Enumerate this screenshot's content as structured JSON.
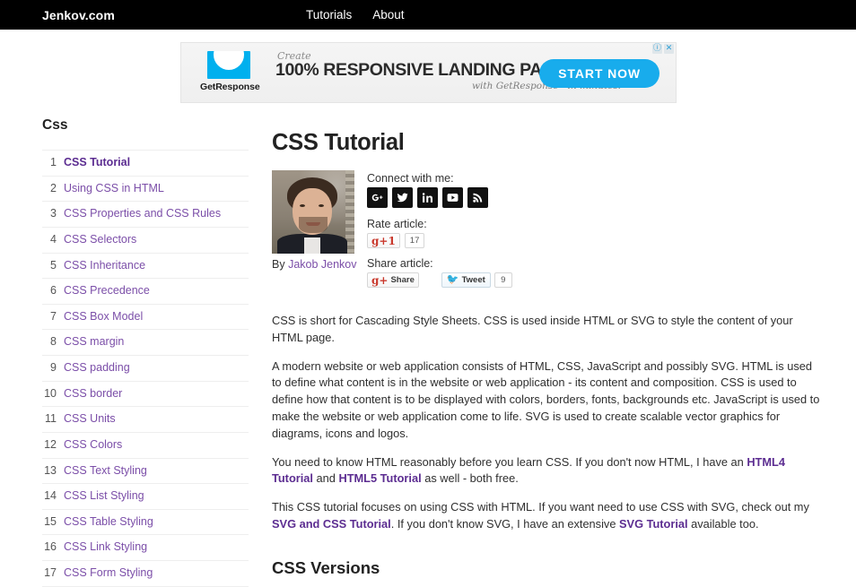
{
  "topnav": {
    "brand": "Jenkov.com",
    "links": [
      {
        "label": "Tutorials"
      },
      {
        "label": "About"
      }
    ]
  },
  "ad": {
    "advertiser": "GetResponse",
    "eyebrow": "Create",
    "headline": "100% RESPONSIVE LANDING PAGES",
    "subline": "with GetResponse - in minutes!",
    "cta_label": "START NOW",
    "info_icon": "info-icon",
    "close_icon": "close-icon",
    "accent_color": "#18acec"
  },
  "sidebar": {
    "title": "Css",
    "items": [
      {
        "num": "1",
        "label": "CSS Tutorial",
        "active": true
      },
      {
        "num": "2",
        "label": "Using CSS in HTML"
      },
      {
        "num": "3",
        "label": "CSS Properties and CSS Rules"
      },
      {
        "num": "4",
        "label": "CSS Selectors"
      },
      {
        "num": "5",
        "label": "CSS Inheritance"
      },
      {
        "num": "6",
        "label": "CSS Precedence"
      },
      {
        "num": "7",
        "label": "CSS Box Model"
      },
      {
        "num": "8",
        "label": "CSS margin"
      },
      {
        "num": "9",
        "label": "CSS padding"
      },
      {
        "num": "10",
        "label": "CSS border"
      },
      {
        "num": "11",
        "label": "CSS Units"
      },
      {
        "num": "12",
        "label": "CSS Colors"
      },
      {
        "num": "13",
        "label": "CSS Text Styling"
      },
      {
        "num": "14",
        "label": "CSS List Styling"
      },
      {
        "num": "15",
        "label": "CSS Table Styling"
      },
      {
        "num": "16",
        "label": "CSS Link Styling"
      },
      {
        "num": "17",
        "label": "CSS Form Styling"
      }
    ],
    "link_color": "#7b4ea8",
    "active_color": "#5c2d91"
  },
  "article": {
    "title": "CSS Tutorial",
    "author_prefix": "By ",
    "author_name": "Jakob Jenkov",
    "connect_label": "Connect with me:",
    "social_icons": [
      {
        "name": "google-plus-icon"
      },
      {
        "name": "twitter-icon"
      },
      {
        "name": "linkedin-icon"
      },
      {
        "name": "youtube-icon"
      },
      {
        "name": "rss-icon"
      }
    ],
    "rate_label": "Rate article:",
    "rate_button": "g+1",
    "rate_count": "17",
    "share_label": "Share article:",
    "share_button": "Share",
    "tweet_button": "Tweet",
    "tweet_count": "9",
    "paragraphs": [
      "CSS is short for Cascading Style Sheets. CSS is used inside HTML or SVG to style the content of your HTML page.",
      "A modern website or web application consists of HTML, CSS, JavaScript and possibly SVG. HTML is used to define what content is in the website or web application - its content and composition. CSS is used to define how that content is to be displayed with colors, borders, fonts, backgrounds etc. JavaScript is used to make the website or web application come to life. SVG is used to create scalable vector graphics for diagrams, icons and logos."
    ],
    "para3": {
      "t1": "You need to know HTML reasonably before you learn CSS. If you don't now HTML, I have an ",
      "l1": "HTML4 Tutorial",
      "t2": " and ",
      "l2": "HTML5 Tutorial",
      "t3": " as well - both free."
    },
    "para4": {
      "t1": "This CSS tutorial focuses on using CSS with HTML. If you want need to use CSS with SVG, check out my ",
      "l1": "SVG and CSS Tutorial",
      "t2": ". If you don't know SVG, I have an extensive ",
      "l2": "SVG Tutorial",
      "t3": " available too."
    },
    "section_heading": "CSS Versions"
  }
}
